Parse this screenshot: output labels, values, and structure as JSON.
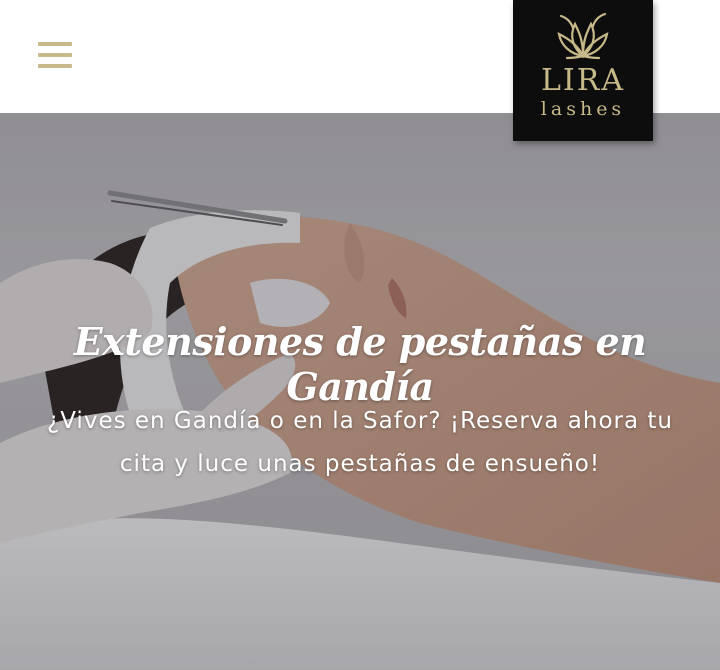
{
  "colors": {
    "accent_gold": "#c8b98a",
    "logo_background": "#0d0d0d",
    "header_background": "#ffffff"
  },
  "header": {
    "menu_icon": "hamburger-menu-icon"
  },
  "logo": {
    "icon": "lotus-icon",
    "brand": "LIRA",
    "sub": "lashes"
  },
  "hero": {
    "title": "Extensiones de pestañas en Gandía",
    "text": "¿Vives en Gandía o en la Safor? ¡Reserva ahora tu cita y luce unas pestañas de ensueño!"
  }
}
